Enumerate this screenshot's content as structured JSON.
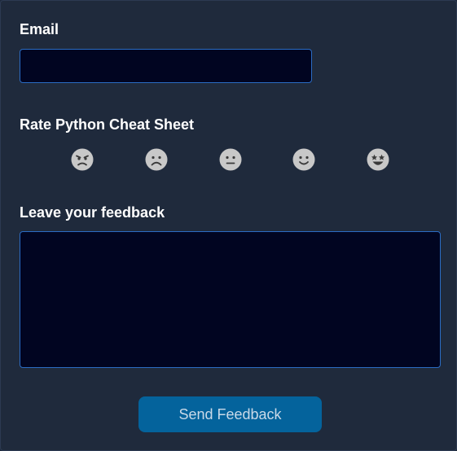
{
  "form": {
    "email_label": "Email",
    "email_value": "",
    "email_placeholder": "",
    "rating_label": "Rate Python Cheat Sheet",
    "ratings": [
      {
        "icon": "angry-face-icon"
      },
      {
        "icon": "frowning-face-icon"
      },
      {
        "icon": "neutral-face-icon"
      },
      {
        "icon": "smiling-face-icon"
      },
      {
        "icon": "star-struck-face-icon"
      }
    ],
    "feedback_label": "Leave your feedback",
    "feedback_value": "",
    "submit_label": "Send Feedback"
  },
  "colors": {
    "background": "#1f2a3c",
    "input_background": "#010521",
    "input_border": "#2b6cc4",
    "button_background": "#04639c",
    "button_text": "#c9d9e8",
    "emoji_fill": "#c8c8c8",
    "emoji_features": "#3a3a3a"
  }
}
